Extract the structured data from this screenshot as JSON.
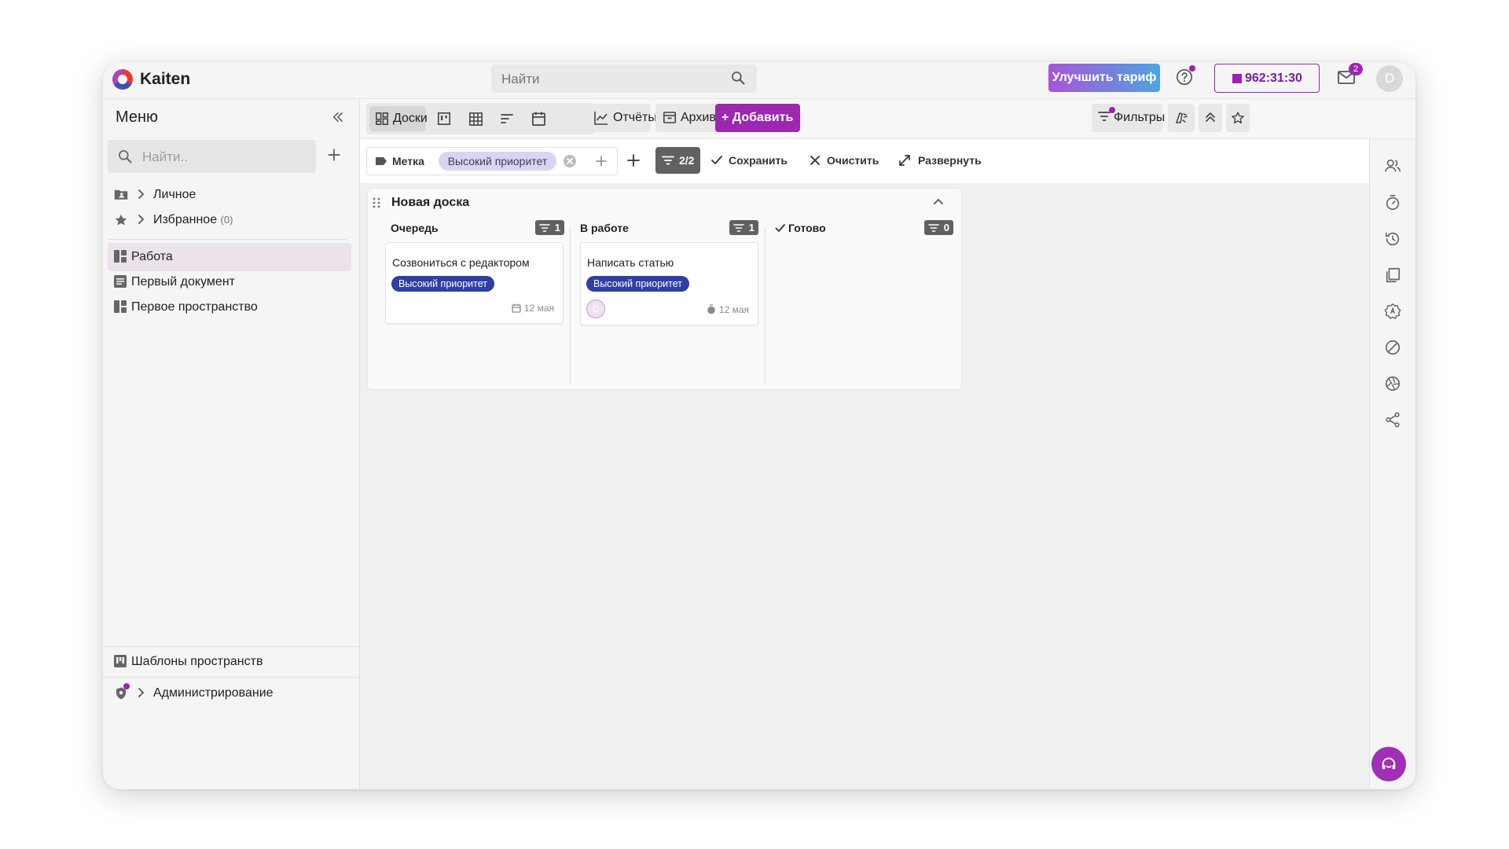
{
  "app": {
    "name": "Kaiten"
  },
  "header": {
    "search_placeholder": "Найти",
    "upgrade_label": "Улучшить тариф",
    "timer": "962:31:30",
    "mail_badge": "2",
    "user_initial": "D"
  },
  "sidebar": {
    "title": "Меню",
    "search_placeholder": "Найти..",
    "tree": [
      {
        "label": "Личное",
        "icon": "folder-user-icon"
      },
      {
        "label": "Избранное",
        "count": "(0)",
        "icon": "star-icon"
      }
    ],
    "items": [
      {
        "label": "Работа",
        "icon": "space-icon",
        "active": true
      },
      {
        "label": "Первый документ",
        "icon": "document-icon"
      },
      {
        "label": "Первое пространство",
        "icon": "space-icon"
      }
    ],
    "templates_label": "Шаблоны пространств",
    "admin_label": "Администрирование"
  },
  "toolbar": {
    "views": [
      {
        "name": "boards",
        "label": "Доски",
        "icon": "board-grid-icon",
        "selected": true
      },
      {
        "name": "kanban",
        "icon": "kanban-icon"
      },
      {
        "name": "table",
        "icon": "table-icon"
      },
      {
        "name": "list",
        "icon": "sort-lines-icon"
      },
      {
        "name": "calendar",
        "icon": "calendar-icon"
      }
    ],
    "reports_label": "Отчёты",
    "archive_label": "Архив",
    "add_label": "Добавить",
    "filters_label": "Фильтры"
  },
  "filterbar": {
    "property_label": "Метка",
    "value_chip": "Высокий приоритет",
    "count": "2/2",
    "save_label": "Сохранить",
    "clear_label": "Очистить",
    "expand_label": "Развернуть"
  },
  "board": {
    "title": "Новая доска",
    "columns": [
      {
        "title": "Очередь",
        "count": "1",
        "cards": [
          {
            "title": "Созвониться с редактором",
            "tag": "Высокий приоритет",
            "date": "12 мая"
          }
        ]
      },
      {
        "title": "В работе",
        "count": "1",
        "cards": [
          {
            "title": "Написать статью",
            "tag": "Высокий приоритет",
            "date": "12 мая",
            "avatar": "D"
          }
        ]
      },
      {
        "title": "Готово",
        "count": "0",
        "cards": []
      }
    ]
  },
  "colors": {
    "accent": "#9c27b0",
    "tag": "#2f3fa5",
    "count_badge": "#616161",
    "active_nav": "#ebe2ec"
  }
}
